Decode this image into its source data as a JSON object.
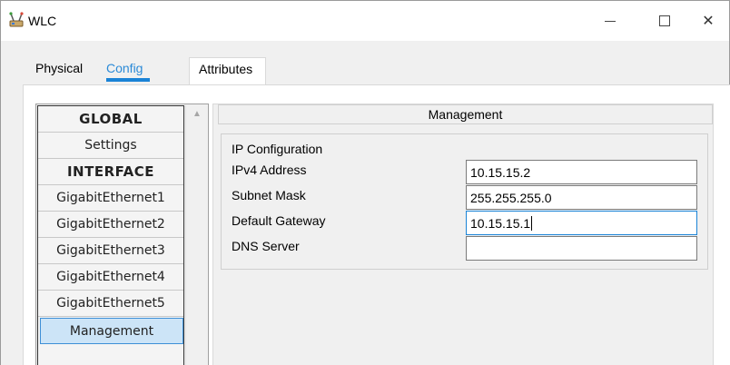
{
  "window": {
    "title": "WLC",
    "controls": {
      "minimize": "—",
      "maximize": "☐",
      "close": "✕"
    }
  },
  "tabs": [
    {
      "label": "Physical",
      "active": false
    },
    {
      "label": "Config",
      "active": true
    },
    {
      "label": "Attributes",
      "active": false
    }
  ],
  "sidebar": {
    "items": [
      {
        "label": "GLOBAL",
        "type": "header"
      },
      {
        "label": "Settings",
        "type": "item"
      },
      {
        "label": "INTERFACE",
        "type": "header"
      },
      {
        "label": "GigabitEthernet1",
        "type": "item"
      },
      {
        "label": "GigabitEthernet2",
        "type": "item"
      },
      {
        "label": "GigabitEthernet3",
        "type": "item"
      },
      {
        "label": "GigabitEthernet4",
        "type": "item"
      },
      {
        "label": "GigabitEthernet5",
        "type": "item"
      },
      {
        "label": "Management",
        "type": "item",
        "selected": true
      }
    ],
    "scroll_up_icon": "▲"
  },
  "main": {
    "section_title": "Management",
    "group_title": "IP Configuration",
    "fields": [
      {
        "label": "IPv4 Address",
        "value": "10.15.15.2"
      },
      {
        "label": "Subnet Mask",
        "value": "255.255.255.0"
      },
      {
        "label": "Default Gateway",
        "value": "10.15.15.1",
        "focused": true
      },
      {
        "label": "DNS Server",
        "value": ""
      }
    ]
  },
  "colors": {
    "accent": "#1a83d6",
    "active_tab_text": "#2b8ad7",
    "selected_item_bg": "#cce4f7",
    "panel_bg": "#f0f0f0"
  }
}
